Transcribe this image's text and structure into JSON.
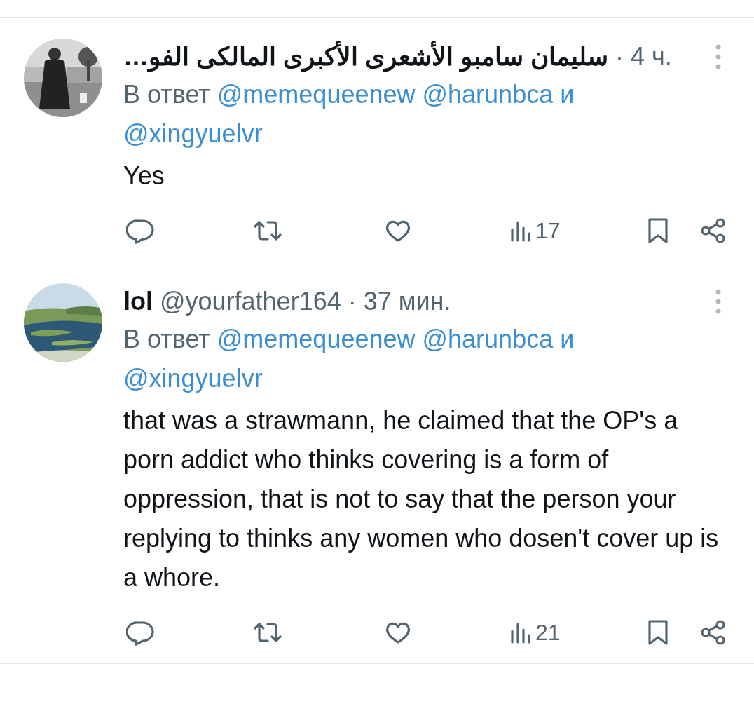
{
  "tweets": [
    {
      "name": "سليمان سامبو الأشعرى الأكبرى المالكى الفو…",
      "time": "· 4 ч.",
      "reply": {
        "prefix": "В ответ",
        "mentions": [
          "@memequeenew",
          "@harunbca"
        ],
        "conjunction": "и",
        "last": "@xingyuelvr"
      },
      "text": "Yes",
      "views": "17"
    },
    {
      "name": "lol",
      "handle": "@yourfather164",
      "time": "· 37 мин.",
      "reply": {
        "prefix": "В ответ",
        "mentions": [
          "@memequeenew",
          "@harunbca"
        ],
        "conjunction": "и",
        "last": "@xingyuelvr"
      },
      "text": "that was a strawmann, he claimed that the OP's a porn addict who thinks covering is a form of oppression, that is not to say that the person your replying to thinks any women who dosen't cover up is a whore.",
      "views": "21"
    }
  ]
}
